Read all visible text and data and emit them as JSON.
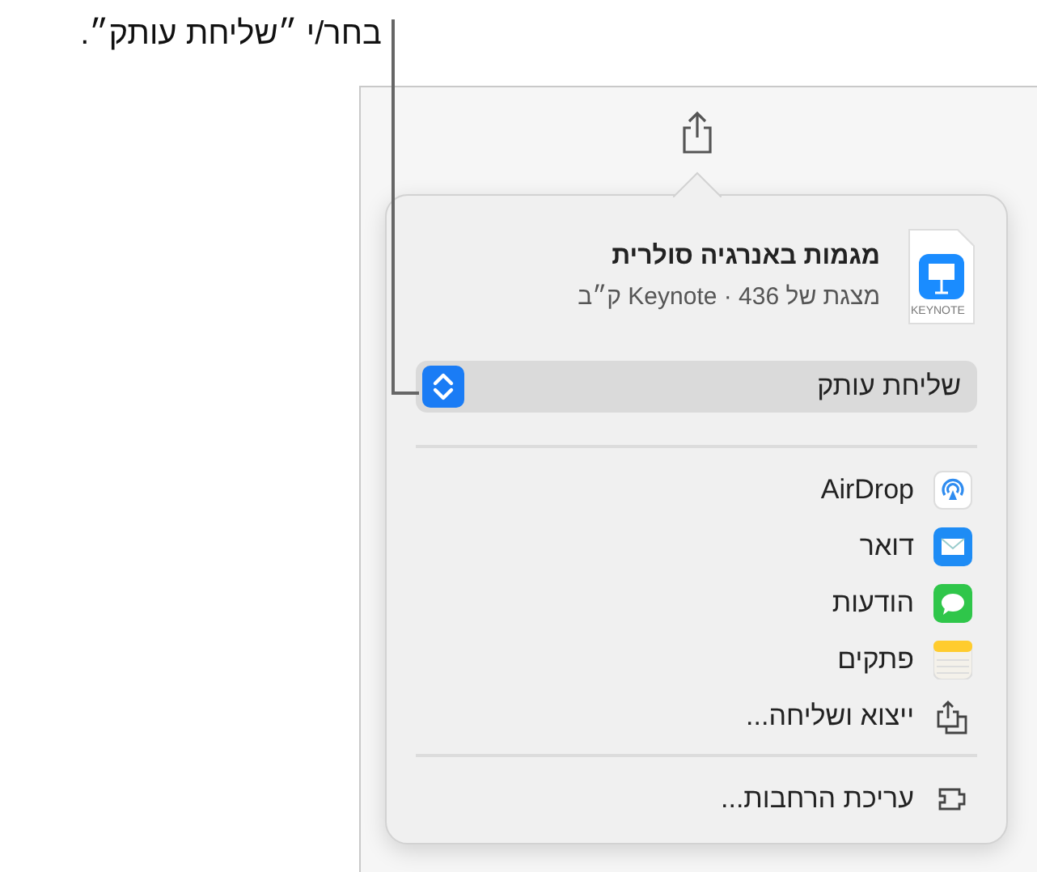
{
  "callout": {
    "text": "בחר/י ״שליחת עותק״."
  },
  "popover": {
    "file": {
      "name": "מגמות באנרגיה סולרית",
      "details": "מצגת של Keynote · 436 ק״ב",
      "icon_label": "KEYNOTE"
    },
    "send_option": {
      "label": "שליחת עותק"
    },
    "items": [
      {
        "label": "AirDrop",
        "kind": "airdrop"
      },
      {
        "label": "דואר",
        "kind": "mail"
      },
      {
        "label": "הודעות",
        "kind": "messages"
      },
      {
        "label": "פתקים",
        "kind": "notes"
      },
      {
        "label": "ייצוא ושליחה...",
        "kind": "export"
      }
    ],
    "footer": {
      "label": "עריכת הרחבות...",
      "kind": "extensions"
    }
  }
}
